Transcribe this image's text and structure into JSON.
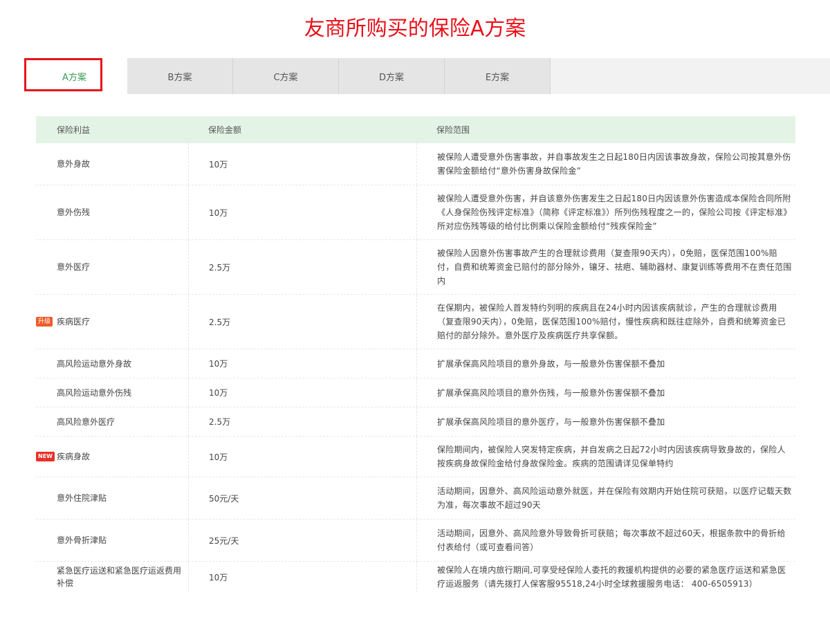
{
  "title": "友商所购买的保险A方案",
  "tabs": [
    {
      "label": "A方案"
    },
    {
      "label": "B方案"
    },
    {
      "label": "C方案"
    },
    {
      "label": "D方案"
    },
    {
      "label": "E方案"
    }
  ],
  "table": {
    "headers": [
      "保险利益",
      "保险金额",
      "保险范围"
    ],
    "rows": [
      {
        "benefit": "意外身故",
        "amount": "10万",
        "scope": "被保险人遭受意外伤害事故，并自事故发生之日起180日内因该事故身故，保险公司按其意外伤害保险金额给付“意外伤害身故保险金”"
      },
      {
        "benefit": "意外伤残",
        "amount": "10万",
        "scope": "被保险人遭受意外伤害，并自该意外伤害发生之日起180日内因该意外伤害造成本保险合同所附《人身保险伤残评定标准》（简称《评定标准》）所列伤残程度之一的，保险公司按《评定标准》所对应伤残等级的给付比例乘以保险金额给付“残疾保险金”"
      },
      {
        "benefit": "意外医疗",
        "amount": "2.5万",
        "scope": "被保险人因意外伤害事故产生的合理就诊费用（复查限90天内），0免赔，医保范围100%赔付，自费和统筹资金已赔付的部分除外，镶牙、祛疤、辅助器材、康复训练等费用不在责任范围内"
      },
      {
        "badge": "升级",
        "benefit": "疾病医疗",
        "amount": "2.5万",
        "scope": "在保期内，被保险人首发特约列明的疾病且在24小时内因该疾病就诊，产生的合理就诊费用（复查限90天内），0免赔，医保范围100%赔付，慢性疾病和既往症除外，自费和统筹资金已赔付的部分除外。意外医疗及疾病医疗共享保额。"
      },
      {
        "benefit": "高风险运动意外身故",
        "amount": "10万",
        "scope": "扩展承保高风险项目的意外身故，与一般意外伤害保额不叠加"
      },
      {
        "benefit": "高风险运动意外伤残",
        "amount": "10万",
        "scope": "扩展承保高风险项目的意外伤残，与一般意外伤害保额不叠加"
      },
      {
        "benefit": "高风险意外医疗",
        "amount": "2.5万",
        "scope": "扩展承保高风险项目的意外医疗，与一般意外伤害保额不叠加"
      },
      {
        "badge": "NEW",
        "benefit": "疾病身故",
        "amount": "10万",
        "scope": "保险期间内，被保险人突发特定疾病，并自发病之日起72小时内因该疾病导致身故的，保险人按疾病身故保险金给付身故保险金。疾病的范围请详见保单特约"
      },
      {
        "benefit": "意外住院津贴",
        "amount": "50元/天",
        "scope": "活动期间，因意外、高风险运动意外就医，并在保险有效期内开始住院可获赔，以医疗记载天数为准，每次事故不超过90天"
      },
      {
        "benefit": "意外骨折津贴",
        "amount": "25元/天",
        "scope": "活动期间，因意外、高风险意外导致骨折可获赔；每次事故不超过60天，根据条款中的骨折给付表给付（或可查看问答）"
      },
      {
        "benefit": "紧急医疗运送和紧急医疗运返费用补偿",
        "amount": "10万",
        "scope": "被保险人在境内旅行期间,可享受经保险人委托的救援机构提供的必要的紧急医疗运送和紧急医疗运返服务（请先拨打人保客服95518,24小时全球救援服务电话： 400-6505913）"
      }
    ]
  },
  "colors": {
    "title": "#e8111a",
    "active_tab": "#3a9d4f",
    "header_bg": "#e3f4e6",
    "badge_up": "#f05a28",
    "badge_new": "#e8302a"
  }
}
